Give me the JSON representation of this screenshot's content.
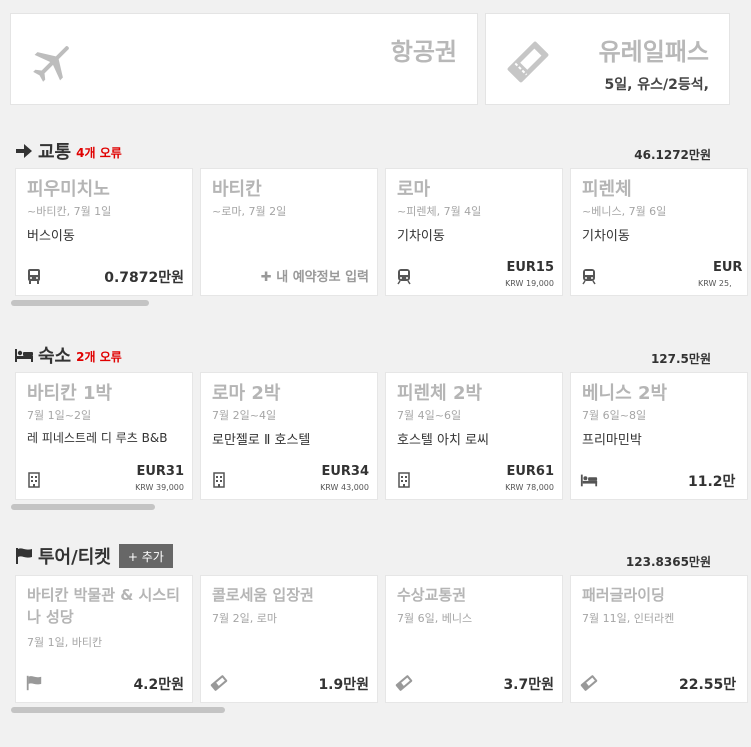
{
  "top": {
    "air": {
      "title": "항공권",
      "icon": "airplane-icon"
    },
    "rail": {
      "title": "유레일패스",
      "sub": "5일, 유스/2등석,",
      "icon": "ticket-icon"
    }
  },
  "transport": {
    "title": "교통",
    "error": "4개 오류",
    "total": "46.1272만원",
    "cards": [
      {
        "title": "피우미치노",
        "sub": "~바티칸, 7월 1일",
        "desc": "버스이동",
        "icon": "bus-icon",
        "price": "0.7872만원"
      },
      {
        "title": "바티칸",
        "sub": "~로마, 7월 2일",
        "desc": "",
        "link": "✚ 내 예약정보 입력"
      },
      {
        "title": "로마",
        "sub": "~피렌체, 7월 4일",
        "desc": "기차이동",
        "icon": "train-icon",
        "eur": "EUR15",
        "krw": "KRW 19,000"
      },
      {
        "title": "피렌체",
        "sub": "~베니스, 7월 6일",
        "desc": "기차이동",
        "icon": "train-icon",
        "eur": "EUR",
        "krw": "KRW 25,"
      }
    ]
  },
  "lodging": {
    "title": "숙소",
    "error": "2개 오류",
    "total": "127.5만원",
    "cards": [
      {
        "title": "바티칸 1박",
        "sub": "7월 1일~2일",
        "desc": "레 피네스트레 디 루츠 B&B",
        "icon": "hotel-icon",
        "eur": "EUR31",
        "krw": "KRW 39,000"
      },
      {
        "title": "로마 2박",
        "sub": "7월 2일~4일",
        "desc": "로만젤로 Ⅱ 호스텔",
        "icon": "hotel-icon",
        "eur": "EUR34",
        "krw": "KRW 43,000"
      },
      {
        "title": "피렌체 2박",
        "sub": "7월 4일~6일",
        "desc": "호스텔 아치 로씨",
        "icon": "hotel-icon",
        "eur": "EUR61",
        "krw": "KRW 78,000"
      },
      {
        "title": "베니스 2박",
        "sub": "7월 6일~8일",
        "desc": "프리마민박",
        "icon": "bed-icon",
        "price": "11.2만"
      }
    ]
  },
  "tours": {
    "title": "투어/티켓",
    "add_label": "+ 추가",
    "total": "123.8365만원",
    "cards": [
      {
        "title": "바티칸 박물관 & 시스티나 성당",
        "sub": "7월 1일, 바티칸",
        "icon": "flag-icon",
        "price": "4.2만원"
      },
      {
        "title": "콜로세움 입장권",
        "sub": "7월 2일, 로마",
        "icon": "ticket-icon",
        "price": "1.9만원"
      },
      {
        "title": "수상교통권",
        "sub": "7월 6일, 베니스",
        "icon": "ticket-icon",
        "price": "3.7만원"
      },
      {
        "title": "패러글라이딩",
        "sub": "7월 11일, 인터라켄",
        "icon": "ticket-icon",
        "price": "22.55만"
      }
    ]
  }
}
